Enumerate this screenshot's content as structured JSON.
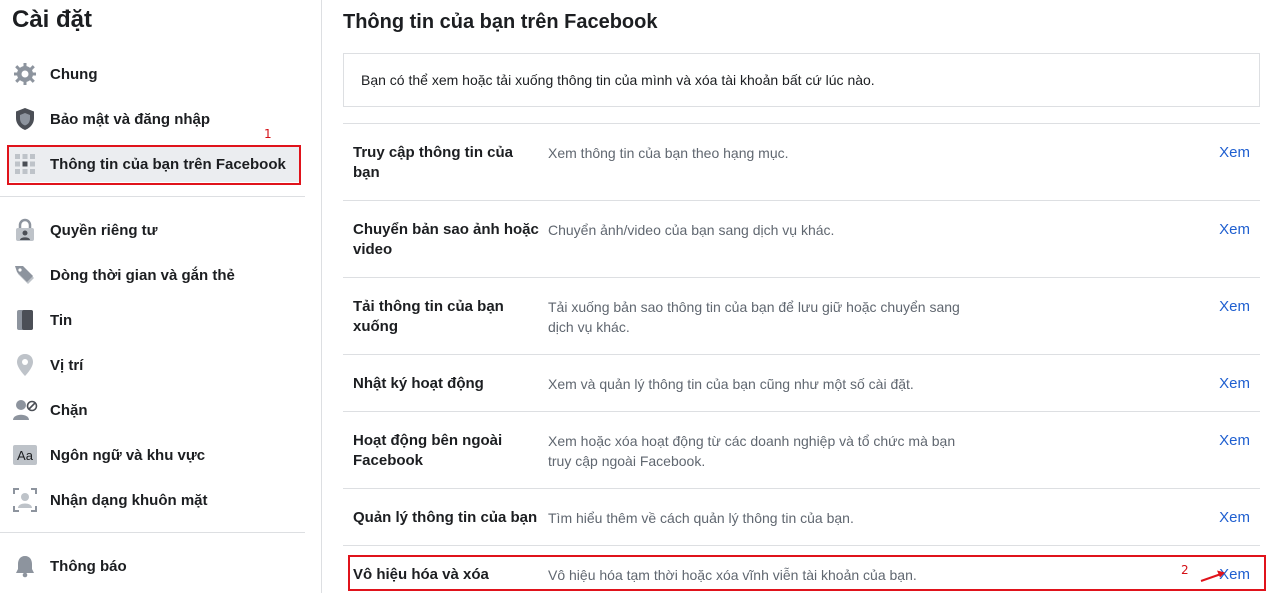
{
  "sidebar": {
    "title": "Cài đặt",
    "items": [
      {
        "label": "Chung",
        "icon": "gear-icon"
      },
      {
        "label": "Bảo mật và đăng nhập",
        "icon": "shield-icon"
      },
      {
        "label": "Thông tin của bạn trên Facebook",
        "icon": "grid-icon",
        "active": true
      },
      {
        "label": "Quyền riêng tư",
        "icon": "lock-person-icon"
      },
      {
        "label": "Dòng thời gian và gắn thẻ",
        "icon": "tag-icon"
      },
      {
        "label": "Tin",
        "icon": "book-icon"
      },
      {
        "label": "Vị trí",
        "icon": "location-pin-icon"
      },
      {
        "label": "Chặn",
        "icon": "block-user-icon"
      },
      {
        "label": "Ngôn ngữ và khu vực",
        "icon": "language-icon"
      },
      {
        "label": "Nhận dạng khuôn mặt",
        "icon": "face-recognition-icon"
      },
      {
        "label": "Thông báo",
        "icon": "bell-icon"
      }
    ]
  },
  "annotations": {
    "marker_1": "1",
    "marker_2": "2",
    "color": "#e0131b"
  },
  "main": {
    "title": "Thông tin của bạn trên Facebook",
    "info": "Bạn có thể xem hoặc tải xuống thông tin của mình và xóa tài khoản bất cứ lúc nào.",
    "link_color": "#1f5fd0",
    "rows": [
      {
        "title": "Truy cập thông tin của bạn",
        "description": "Xem thông tin của bạn theo hạng mục.",
        "action": "Xem"
      },
      {
        "title": "Chuyển bản sao ảnh hoặc video",
        "description": "Chuyển ảnh/video của bạn sang dịch vụ khác.",
        "action": "Xem"
      },
      {
        "title": "Tải thông tin của bạn xuống",
        "description": "Tải xuống bản sao thông tin của bạn để lưu giữ hoặc chuyển sang dịch vụ khác.",
        "action": "Xem"
      },
      {
        "title": "Nhật ký hoạt động",
        "description": "Xem và quản lý thông tin của bạn cũng như một số cài đặt.",
        "action": "Xem"
      },
      {
        "title": "Hoạt động bên ngoài Facebook",
        "description": "Xem hoặc xóa hoạt động từ các doanh nghiệp và tổ chức mà bạn truy cập ngoài Facebook.",
        "action": "Xem"
      },
      {
        "title": "Quản lý thông tin của bạn",
        "description": "Tìm hiểu thêm về cách quản lý thông tin của bạn.",
        "action": "Xem"
      },
      {
        "title": "Vô hiệu hóa và xóa",
        "description": "Vô hiệu hóa tạm thời hoặc xóa vĩnh viễn tài khoản của bạn.",
        "action": "Xem"
      }
    ]
  }
}
